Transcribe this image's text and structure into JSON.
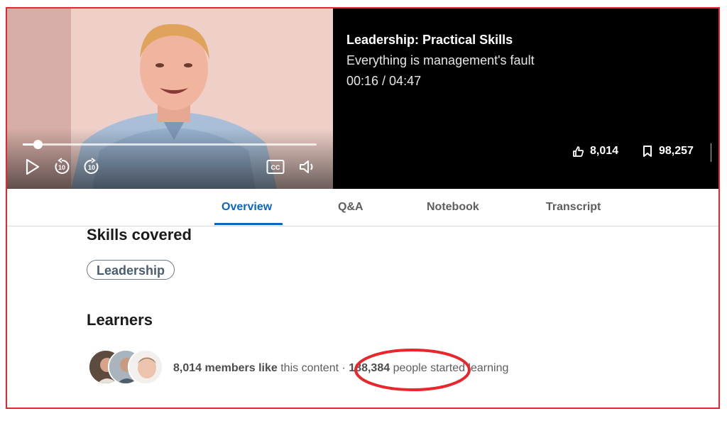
{
  "player": {
    "progress_fraction": 0.05,
    "course_title": "Leadership: Practical Skills",
    "video_title": "Everything is management's fault",
    "time": "00:16 / 04:47",
    "likes": "8,014",
    "saves": "98,257",
    "icons": [
      "play-icon",
      "rewind-10-icon",
      "forward-10-icon",
      "cc-icon",
      "volume-icon",
      "like-icon",
      "bookmark-icon"
    ]
  },
  "tabs": [
    "Overview",
    "Q&A",
    "Notebook",
    "Transcript"
  ],
  "skills": {
    "heading": "Skills covered",
    "items": [
      "Leadership"
    ]
  },
  "learners": {
    "heading": "Learners",
    "members_count": "8,014 members like",
    "members_suffix": "this content",
    "separator": "·",
    "people_count": "188,384",
    "people_suffix": "people started learning"
  },
  "colors": {
    "accent": "#0a66c2",
    "highlight": "#e8262b"
  }
}
